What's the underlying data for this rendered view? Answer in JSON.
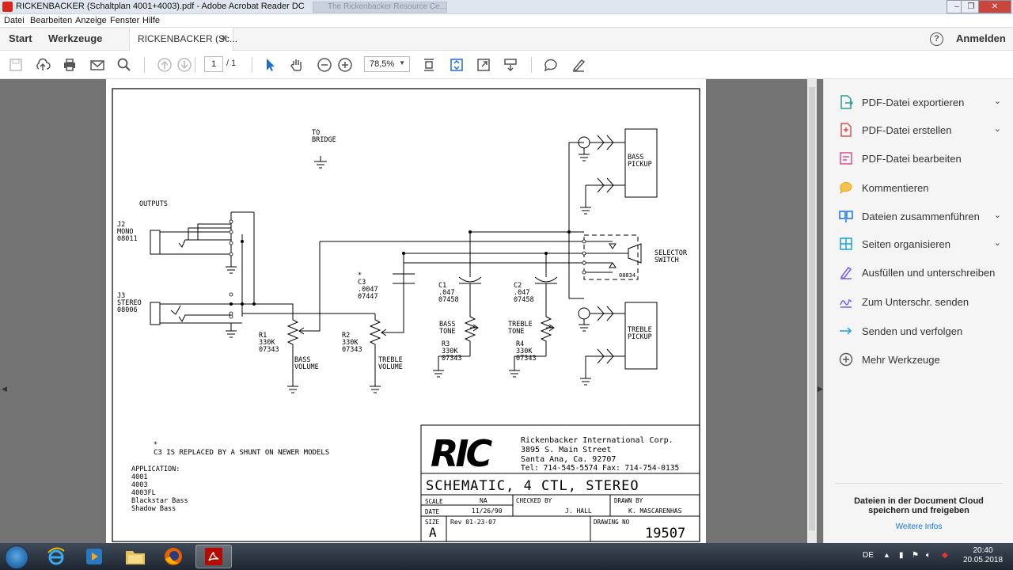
{
  "window": {
    "title": "RICKENBACKER (Schaltplan 4001+4003).pdf - Adobe Acrobat Reader DC",
    "background_tab": "The Rickenbacker Resource Ce..."
  },
  "menu": [
    "Datei",
    "Bearbeiten",
    "Anzeige",
    "Fenster",
    "Hilfe"
  ],
  "tabs": {
    "home": "Start",
    "tools": "Werkzeuge",
    "document": "RICKENBACKER (Sc...",
    "sign_in": "Anmelden"
  },
  "toolbar": {
    "page_current": "1",
    "page_total": "/ 1",
    "zoom": "78,5%"
  },
  "schematic": {
    "to_bridge": [
      "TO",
      "BRIDGE"
    ],
    "outputs": "OUTPUTS",
    "j2": [
      "J2",
      "MONO",
      "08011"
    ],
    "j3": [
      "J3",
      "STEREO",
      "08006"
    ],
    "bass_pickup": [
      "BASS",
      "PICKUP"
    ],
    "treble_pickup": [
      "TREBLE",
      "PICKUP"
    ],
    "selector": [
      "SELECTOR",
      "SWITCH"
    ],
    "selector_part": "08834",
    "c3": [
      "C3",
      ".0047",
      "07447"
    ],
    "c1": [
      "C1",
      ".047",
      "07458"
    ],
    "c2": [
      "C2",
      ".047",
      "07458"
    ],
    "r1": [
      "R1",
      "330K",
      "07343"
    ],
    "r2": [
      "R2",
      "330K",
      "07343"
    ],
    "r3": [
      "R3",
      "330K",
      "07343"
    ],
    "r4": [
      "R4",
      "330K",
      "07343"
    ],
    "bass_volume": [
      "BASS",
      "VOLUME"
    ],
    "treble_volume": [
      "TREBLE",
      "VOLUME"
    ],
    "bass_tone": [
      "BASS",
      "TONE"
    ],
    "treble_tone": [
      "TREBLE",
      "TONE"
    ],
    "asterisk": "*",
    "note": "C3 IS REPLACED BY A SHUNT ON NEWER MODELS",
    "application": [
      "APPLICATION:",
      "4001",
      "4003",
      "4003FL",
      "Blackstar Bass",
      "Shadow Bass"
    ],
    "logo": "RIC",
    "company": [
      "Rickenbacker International Corp.",
      "3895 S. Main Street",
      "Santa Ana, Ca. 92707",
      "Tel: 714-545-5574  Fax: 714-754-0135"
    ],
    "drawing_title": "SCHEMATIC, 4 CTL, STEREO",
    "scale_label": "SCALE",
    "scale": "NA",
    "date_label": "DATE",
    "date": "11/26/90",
    "checked_label": "CHECKED BY",
    "checked": "J. HALL",
    "drawn_label": "DRAWN BY",
    "drawn": "K. MASCARENHAS",
    "size_label": "SIZE",
    "size": "A",
    "rev": "Rev 01-23-07",
    "drawing_no_label": "DRAWING NO",
    "drawing_no": "19507"
  },
  "right_panel": {
    "items": [
      {
        "label": "PDF-Datei exportieren",
        "icon": "export-pdf-icon",
        "chevron": true
      },
      {
        "label": "PDF-Datei erstellen",
        "icon": "create-pdf-icon",
        "chevron": true
      },
      {
        "label": "PDF-Datei bearbeiten",
        "icon": "edit-pdf-icon",
        "chevron": false
      },
      {
        "label": "Kommentieren",
        "icon": "comment-icon",
        "chevron": false
      },
      {
        "label": "Dateien zusammenführen",
        "icon": "combine-files-icon",
        "chevron": true
      },
      {
        "label": "Seiten organisieren",
        "icon": "organize-pages-icon",
        "chevron": true
      },
      {
        "label": "Ausfüllen und unterschreiben",
        "icon": "fill-sign-icon",
        "chevron": false
      },
      {
        "label": "Zum Unterschr. senden",
        "icon": "send-for-signature-icon",
        "chevron": false
      },
      {
        "label": "Senden und verfolgen",
        "icon": "send-track-icon",
        "chevron": false
      },
      {
        "label": "Mehr Werkzeuge",
        "icon": "more-tools-icon",
        "chevron": false
      }
    ],
    "cloud_text": "Dateien in der Document Cloud speichern und freigeben",
    "more_info": "Weitere Infos"
  },
  "taskbar": {
    "lang": "DE",
    "time": "20:40",
    "date": "20.05.2018"
  }
}
